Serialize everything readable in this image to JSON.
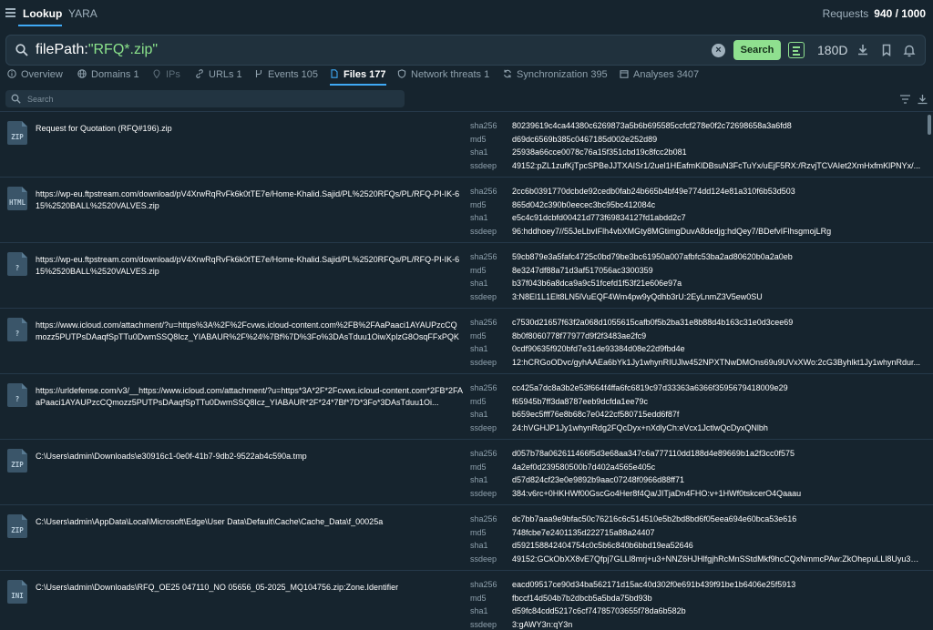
{
  "topbar": {
    "tabs": [
      "Lookup",
      "YARA"
    ],
    "requests_label": "Requests",
    "requests_value": "940 / 1000"
  },
  "search": {
    "query_key": "filePath:",
    "query_value": "\"RFQ*.zip\"",
    "search_label": "Search",
    "range": "180D"
  },
  "tabs": [
    {
      "label": "Overview",
      "icon": "info-icon"
    },
    {
      "label": "Domains 1",
      "icon": "globe-icon"
    },
    {
      "label": "IPs",
      "icon": "location-pin-icon"
    },
    {
      "label": "URLs 1",
      "icon": "link-icon"
    },
    {
      "label": "Events 105",
      "icon": "branch-icon"
    },
    {
      "label": "Files 177",
      "icon": "file-icon"
    },
    {
      "label": "Network threats 1",
      "icon": "shield-icon"
    },
    {
      "label": "Synchronization 395",
      "icon": "sync-icon"
    },
    {
      "label": "Analyses 3407",
      "icon": "calendar-icon"
    }
  ],
  "filter": {
    "placeholder": "Search"
  },
  "hash_labels": [
    "sha256",
    "md5",
    "sha1",
    "ssdeep"
  ],
  "files": [
    {
      "ext": "ZIP",
      "name": "Request for Quotation (RFQ#196).zip",
      "sha256": "80239619c4ca44380c6269873a5b6b695585ccfcf278e0f2c72698658a3a6fd8",
      "md5": "d69dc6569b385c0467185d002e252d89",
      "sha1": "25938a66cce0078c76a15f351cbd19c8fcc2b081",
      "ssdeep": "49152:pZL1zufKjTpcSPBeJJTXAISr1/2uel1HEafmKlDBsuN3FcTuYx/uEjF5RX:/RzvjTCVAIet2XmHxfmKlPNYx/..."
    },
    {
      "ext": "HTML",
      "name": "https://wp-eu.ftpstream.com/download/pV4XrwRqRvFk6k0tTE7e/Home-Khalid.Sajid/PL%2520RFQs/PL/RFQ-PI-IK-615%2520BALL%2520VALVES.zip",
      "sha256": "2cc6b0391770dcbde92cedb0fab24b665b4bf49e774dd124e81a310f6b53d503",
      "md5": "865d042c390b0eecec3bc95bc412084c",
      "sha1": "e5c4c91dcbfd00421d773f69834127fd1abdd2c7",
      "ssdeep": "96:hddhoey7//55JeLbvIFlh4vbXMGty8MGtimgDuvA8dedjg:hdQey7/BDefvIFlhsgmojLRg"
    },
    {
      "ext": "?",
      "name": "https://wp-eu.ftpstream.com/download/pV4XrwRqRvFk6k0tTE7e/Home-Khalid.Sajid/PL%2520RFQs/PL/RFQ-PI-IK-615%2520BALL%2520VALVES.zip",
      "sha256": "59cb879e3a5fafc4725c0bd79be3bc61950a007afbfc53ba2ad80620b0a2a0eb",
      "md5": "8e3247df88a71d3af517056ac3300359",
      "sha1": "b37f043b6a8dca9a9c51fcefd1f53f21e606e97a",
      "ssdeep": "3:N8El1L1Elt8LN5lVuEQF4Wm4pw9yQdhb3rU:2EyLnmZ3V5ew0SU"
    },
    {
      "ext": "?",
      "name": "https://www.icloud.com/attachment/?u=https%3A%2F%2Fcvws.icloud-content.com%2FB%2FAaPaaci1AYAUPzcCQmozz5PUTPsDAaqfSpTTu0DwmSSQ8Icz_YIABAUR%2F%24%7Bf%7D%3Fo%3DAsTduu1OiwXplzG8OsqFFxPQKU_...",
      "sha256": "c7530d21657f63f2a068d1055615cafb0f5b2ba31e8b88d4b163c31e0d3cee69",
      "md5": "8b0f8060778f77977d9f2f3483ae2fc9",
      "sha1": "0cdf90635f920bfd7e31de93384d08e22d9fbd4e",
      "ssdeep": "12:hCRGoODvc/gyhAAEa6bYk1Jy1whynRIUJlw452NPXTNwDMOns69u9UVxXWo:2cG3Byhlkt1Jy1whynRdur..."
    },
    {
      "ext": "?",
      "name": "https://urldefense.com/v3/__https://www.icloud.com/attachment/?u=https*3A*2F*2Fcvws.icloud-content.com*2FB*2FAaPaaci1AYAUPzcCQmozz5PUTPsDAaqfSpTTu0DwmSSQ8Icz_YIABAUR*2F*24*7Bf*7D*3Fo*3DAsTduu1Oi...",
      "sha256": "cc425a7dc8a3b2e53f664f4ffa6fc6819c97d33363a6366f3595679418009e29",
      "md5": "f65945b7ff3da8787eeb9dcfda1ee79c",
      "sha1": "b659ec5fff76e8b68c7e0422cf580715edd6f87f",
      "ssdeep": "24:hVGHJP1Jy1whynRdg2FQcDyx+nXdlyCh:eVcx1JctlwQcDyxQNlbh"
    },
    {
      "ext": "ZIP",
      "name": "C:\\Users\\admin\\Downloads\\e30916c1-0e0f-41b7-9db2-9522ab4c590a.tmp",
      "sha256": "d057b78a062611466f5d3e68aa347c6a777110dd188d4e89669b1a2f3cc0f575",
      "md5": "4a2ef0d239580500b7d402a4565e405c",
      "sha1": "d57d824cf23e0e9892b9aac07248f0966d88ff71",
      "ssdeep": "384:v6rc+0HKHWf00GscGo4Her8f4Qa/JITjaDn4FHO:v+1HWf0tskcerO4Qaaau"
    },
    {
      "ext": "ZIP",
      "name": "C:\\Users\\admin\\AppData\\Local\\Microsoft\\Edge\\User Data\\Default\\Cache\\Cache_Data\\f_00025a",
      "sha256": "dc7bb7aaa9e9bfac50c76216c6c514510e5b2bd8bd6f05eea694e60bca53e616",
      "md5": "748fcbe7e2401135d222715a88a24407",
      "sha1": "d592158842404754c0c5b6c840b6bbd19ea52646",
      "ssdeep": "49152:GCkObXX8vE7Qfpj7GLLl8mrj+u3+NNZ6HJHlfgjhRcMnSStdMkf9hcCQxNmmcPAw:ZkOhepuLLl8Uyu3+..."
    },
    {
      "ext": "INI",
      "name": "C:\\Users\\admin\\Downloads\\RFQ_OE25 047110_NO 05656_05-2025_MQ104756.zip:Zone.Identifier",
      "sha256": "eacd09517ce90d34ba562171d15ac40d302f0e691b439f91be1b6406e25f5913",
      "md5": "fbccf14d504b7b2dbcb5a5bda75bd93b",
      "sha1": "d59fc84cdd5217c6cf74785703655f78da6b582b",
      "ssdeep": "3:gAWY3n:qY3n"
    }
  ],
  "colors": {
    "background": "#16242e",
    "accent_blue": "#3fa9f5",
    "accent_green": "#8fe08f",
    "query_value": "#8be38b"
  }
}
